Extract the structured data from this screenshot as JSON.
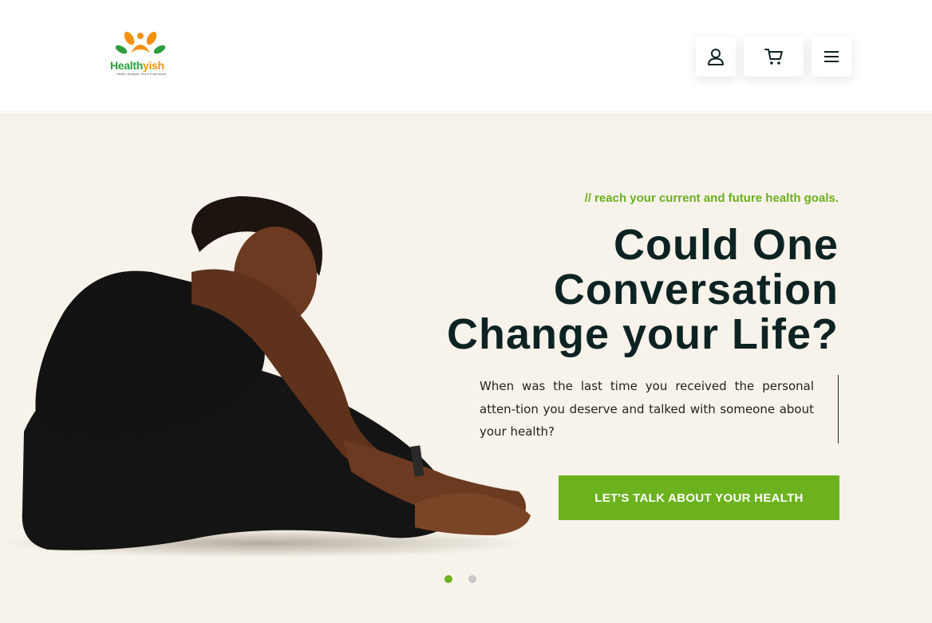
{
  "brand": {
    "name_part1": "Health",
    "name_part2": "yish",
    "tagline": "Health, Analysis, Sell & Experience"
  },
  "header": {
    "icons": [
      "user-icon",
      "cart-icon",
      "menu-icon"
    ]
  },
  "hero": {
    "tagline": "// reach your current and future health goals.",
    "headline_lines": [
      "Could One",
      "Conversation",
      "Change your Life?"
    ],
    "intro_text": "When was the last time you received the personal atten-tion you deserve and talked with someone about your health?",
    "cta_label": "LET'S TALK ABOUT YOUR HEALTH",
    "slides": {
      "count": 2,
      "active": 1
    }
  },
  "colors": {
    "accent": "#6cb21e",
    "headline": "#0d2323",
    "hero_bg": "#f7f3ea",
    "logo_green": "#2e9e3e",
    "logo_orange": "#f29111"
  }
}
